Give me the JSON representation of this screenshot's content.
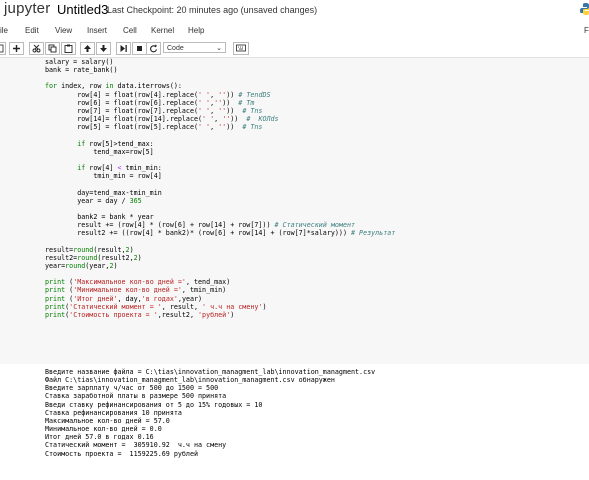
{
  "header": {
    "logo": "jupyter",
    "notebook_name": "Untitled3",
    "checkpoint": "Last Checkpoint: 20 minutes ago (unsaved changes)"
  },
  "menu": {
    "items": [
      "ile",
      "Edit",
      "View",
      "Insert",
      "Cell",
      "Kernel",
      "Help"
    ],
    "right_fragment": "F"
  },
  "toolbar": {
    "cell_type": "Code"
  },
  "code": {
    "l01": "salary = salary()",
    "l02": "bank = rate_bank()",
    "l03": "",
    "l04_kw": "for",
    "l04_a": " index, row ",
    "l04_kw2": "in",
    "l04_b": " data.iterrows():",
    "l05_a": "        row[4] = float(row[4].replace(",
    "l05_s1": "' '",
    "l05_b": ", ",
    "l05_s2": "''",
    "l05_c": ")) ",
    "l05_c_cm": "# TendDS",
    "l06_a": "        row[6] = float(row[6].replace(",
    "l06_s1": "' '",
    "l06_b": ",",
    "l06_s2": "''",
    "l06_c": "))  ",
    "l06_c_cm": "# Tm",
    "l07_a": "        row[7] = float(row[7].replace(",
    "l07_s1": "' '",
    "l07_b": ", ",
    "l07_s2": "''",
    "l07_c": "))  ",
    "l07_c_cm": "# Tns",
    "l08_a": "        row[14]= float(row[14].replace(",
    "l08_s1": "' '",
    "l08_b": ", ",
    "l08_s2": "''",
    "l08_c": "))  ",
    "l08_c_cm": "#  КОЛds",
    "l09_a": "        row[5] = float(row[5].replace(",
    "l09_s1": "' '",
    "l09_b": ", ",
    "l09_s2": "''",
    "l09_c": "))  ",
    "l09_c_cm": "# Tns",
    "l10": "",
    "l11_kw": "        if",
    "l11_a": " row[5]>tend_max:",
    "l12": "            tend_max=row[5]",
    "l13": "",
    "l14_kw": "        if",
    "l14_a": " row[4] ",
    "l14_op": "<",
    "l14_b": " tmin_min:",
    "l15": "            tmin_min = row[4]",
    "l16": "",
    "l17": "        day=tend_max-tmin_min",
    "l18_a": "        year = day / ",
    "l18_num": "365",
    "l19": "",
    "l20": "        bank2 = bank * year",
    "l21_a": "        result += (row[4] * (row[6] + row[14] + row[7])) ",
    "l21_cm": "# Статический момент",
    "l22_a": "        result2 += ((row[4] * bank2)* (row[6] + row[14] + (row[7]*salary))) ",
    "l22_cm": "# Результат",
    "l23": "",
    "l24_a": "result=",
    "l24_kw": "round",
    "l24_b": "(result,",
    "l24_num": "2",
    "l24_c": ")",
    "l25_a": "result2=",
    "l25_kw": "round",
    "l25_b": "(result2,",
    "l25_num": "2",
    "l25_c": ")",
    "l26_a": "year=",
    "l26_kw": "round",
    "l26_b": "(year,",
    "l26_num": "2",
    "l26_c": ")",
    "l27": "",
    "l28_kw": "print",
    "l28_a": " (",
    "l28_s": "'Максимальное кол-во дней ='",
    "l28_b": ", tend_max)",
    "l29_kw": "print",
    "l29_a": " (",
    "l29_s": "'Минимальное кол-во дней ='",
    "l29_b": ", tmin_min)",
    "l30_kw": "print",
    "l30_a": " (",
    "l30_s": "'Итог дней'",
    "l30_b": ", day,",
    "l30_s2": "'в годах'",
    "l30_c": ",year)",
    "l31_kw": "print",
    "l31_a": "(",
    "l31_s": "'Статический момент = '",
    "l31_b": ", result, ",
    "l31_s2": "' ч.ч на смену'",
    "l31_c": ")",
    "l32_kw": "print",
    "l32_a": "(",
    "l32_s": "'Стоимость проекта = '",
    "l32_b": ",result2, ",
    "l32_s2": "'рублей'",
    "l32_c": ")"
  },
  "output": [
    "Введите название файла = C:\\tias\\innovation_managment_lab\\innovation_managment.csv",
    "Файл C:\\tias\\innovation_managment_lab\\innovation_managment.csv обнаружен",
    "Введите зарплату ч/час от 500 до 1500 = 500",
    "Ставка заработной платы в размере 500 принята",
    "Введи ставку рефинансирования от 5 до 15% годовых = 10",
    "Ставка рефинансирования 10 принята",
    "Максимальное кол-во дней = 57.0",
    "Минимальное кол-во дней = 0.0",
    "Итог дней 57.0 в годах 0.16",
    "Статический момент =  305910.92  ч.ч на смену",
    "Стоимость проекта =  1159225.69 рублей"
  ]
}
